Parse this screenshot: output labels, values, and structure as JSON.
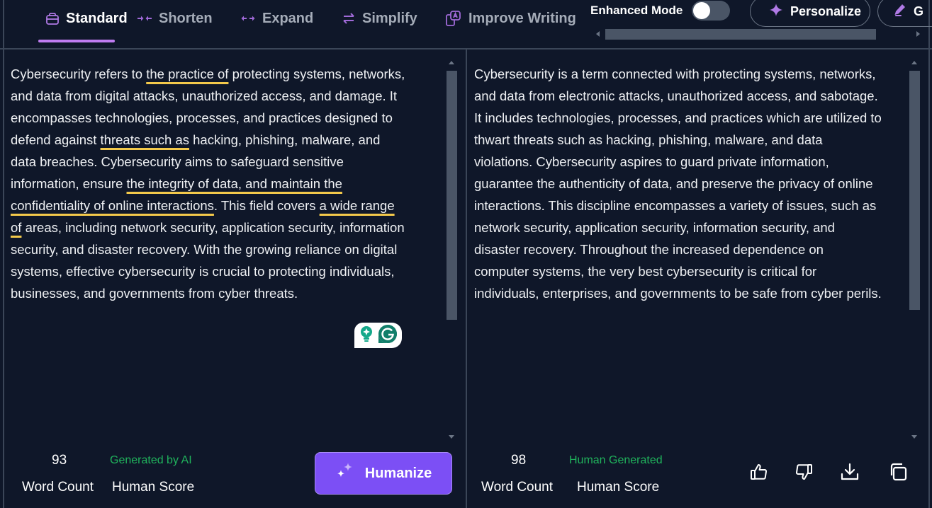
{
  "toolbar": {
    "tabs": [
      {
        "label": "Standard",
        "icon": "bag-icon",
        "active": true
      },
      {
        "label": "Shorten",
        "icon": "arrows-in-icon",
        "active": false
      },
      {
        "label": "Expand",
        "icon": "arrows-out-icon",
        "active": false
      },
      {
        "label": "Simplify",
        "icon": "swap-arrows-icon",
        "active": false
      },
      {
        "label": "Improve Writing",
        "icon": "improve-writing-icon",
        "active": false
      }
    ],
    "enhanced_mode": {
      "label": "Enhanced Mode",
      "enabled": false
    },
    "personalize_label": "Personalize",
    "truncated_button_label": "G"
  },
  "input_panel": {
    "segments": [
      {
        "text": "Cybersecurity refers to ",
        "highlight": false
      },
      {
        "text": "the practice of",
        "highlight": true
      },
      {
        "text": " protecting systems, networks, and data from digital attacks, unauthorized access, and damage. It encompasses technologies, processes, and practices designed to defend against ",
        "highlight": false
      },
      {
        "text": "threats such as",
        "highlight": true
      },
      {
        "text": " hacking, phishing, malware, and data breaches. Cybersecurity aims to safeguard sensitive information, ensure ",
        "highlight": false
      },
      {
        "text": "the integrity of data, and maintain the confidentiality of online interactions",
        "highlight": true
      },
      {
        "text": ". This field covers ",
        "highlight": false
      },
      {
        "text": "a wide range of",
        "highlight": true
      },
      {
        "text": " areas, including network security, application security, information security, and disaster recovery. With the growing reliance on digital systems, effective cybersecurity is crucial to protecting individuals, businesses, and governments from cyber threats.",
        "highlight": false
      }
    ],
    "word_count": "93",
    "word_count_label": "Word Count",
    "human_score_status": "Generated by AI",
    "human_score_label": "Human Score",
    "humanize_label": "Humanize"
  },
  "output_panel": {
    "text": "Cybersecurity is a term connected with protecting systems, networks, and data from electronic attacks, unauthorized access, and sabotage. It includes technologies, processes, and practices which are utilized to thwart threats such as hacking, phishing, malware, and data violations. Cybersecurity aspires to guard private information, guarantee the authenticity of data, and preserve the privacy of online interactions. This discipline encompasses a variety of issues, such as network security, application security, information security, and disaster recovery. Throughout the increased dependence on computer systems, the very best cybersecurity is critical for individuals, enterprises, and governments to be safe from cyber perils.",
    "word_count": "98",
    "word_count_label": "Word Count",
    "human_score_status": "Human Generated",
    "human_score_label": "Human Score",
    "actions": [
      "thumbs-up-icon",
      "thumbs-down-icon",
      "download-icon",
      "copy-icon"
    ]
  },
  "colors": {
    "background": "#0f1729",
    "accent": "#7c4ff5",
    "tab_icon": "#a06ad8",
    "highlight_underline": "#f3c94b",
    "status_green": "#20b35c",
    "border": "#3b4658"
  }
}
